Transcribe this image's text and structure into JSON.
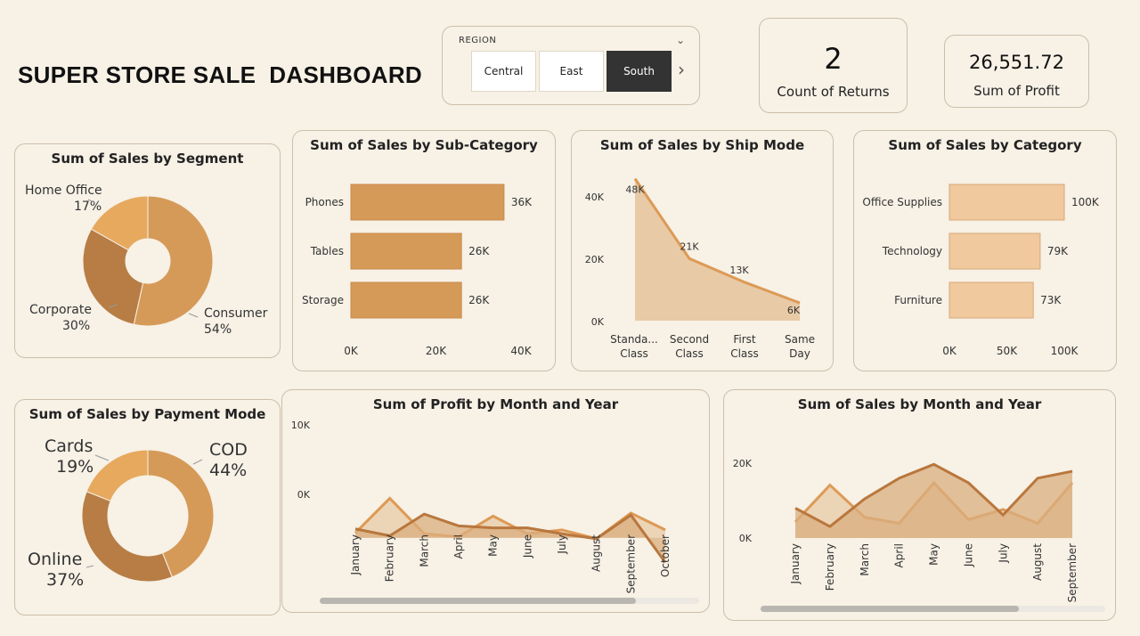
{
  "title": "SUPER STORE SALE  DASHBOARD",
  "slicer": {
    "label": "REGION",
    "options": [
      "Central",
      "East",
      "South"
    ],
    "selected": "South"
  },
  "kpis": {
    "returns": {
      "value": "2",
      "label": "Count of Returns"
    },
    "profit": {
      "value": "26,551.72",
      "label": "Sum of Profit"
    }
  },
  "colors": {
    "bg": "#f7f1e6",
    "seg_consumer": "#d69a58",
    "seg_corporate": "#b77d45",
    "seg_home": "#e7a95e",
    "bar": "#d69a58",
    "cat_bar": "#f0c99e",
    "area_fill": "#e8caa6",
    "line_dark": "#b9773d",
    "line_light": "#dd9a55"
  },
  "chart_data": [
    {
      "id": "segment",
      "type": "pie",
      "title": "Sum of Sales by Segment",
      "labels": [
        "Consumer",
        "Corporate",
        "Home Office"
      ],
      "values": [
        54,
        30,
        17
      ],
      "value_labels": [
        "54%",
        "30%",
        "17%"
      ]
    },
    {
      "id": "subcat",
      "type": "bar",
      "title": "Sum of Sales by Sub-Category",
      "categories": [
        "Phones",
        "Tables",
        "Storage"
      ],
      "values": [
        36,
        26,
        26
      ],
      "value_labels": [
        "36K",
        "26K",
        "26K"
      ],
      "ticks": [
        "0K",
        "20K",
        "40K"
      ],
      "xlim": [
        0,
        40
      ]
    },
    {
      "id": "shipmode",
      "type": "area",
      "title": "Sum of Sales by Ship Mode",
      "categories": [
        "Standa...\nClass",
        "Second\nClass",
        "First\nClass",
        "Same\nDay"
      ],
      "values": [
        48,
        21,
        13,
        6
      ],
      "value_labels": [
        "48K",
        "21K",
        "13K",
        "6K"
      ],
      "ticks": [
        "0K",
        "20K",
        "40K"
      ],
      "ylim": [
        0,
        50
      ]
    },
    {
      "id": "category",
      "type": "bar",
      "title": "Sum of Sales by Category",
      "categories": [
        "Office Supplies",
        "Technology",
        "Furniture"
      ],
      "values": [
        100,
        79,
        73
      ],
      "value_labels": [
        "100K",
        "79K",
        "73K"
      ],
      "ticks": [
        "0K",
        "50K",
        "100K"
      ],
      "xlim": [
        0,
        100
      ]
    },
    {
      "id": "payment",
      "type": "pie",
      "title": "Sum of Sales by Payment Mode",
      "labels": [
        "COD",
        "Online",
        "Cards"
      ],
      "values": [
        44,
        37,
        19
      ],
      "value_labels": [
        "44%",
        "37%",
        "19%"
      ]
    },
    {
      "id": "profit_month",
      "type": "area",
      "title": "Sum of Profit by Month and Year",
      "categories": [
        "January",
        "February",
        "March",
        "April",
        "May",
        "June",
        "July",
        "August",
        "September",
        "October"
      ],
      "series": [
        {
          "values": [
            0.5,
            4.0,
            0.4,
            0.1,
            2.2,
            0.4,
            0.8,
            -0.1,
            2.5,
            0.8
          ]
        },
        {
          "values": [
            0.9,
            0.2,
            2.4,
            1.2,
            1.0,
            1.0,
            0.4,
            -0.1,
            2.3,
            -2.5
          ]
        }
      ],
      "ticks": [
        "0K",
        "10K"
      ],
      "ylim": [
        -4,
        10
      ]
    },
    {
      "id": "sales_month",
      "type": "area",
      "title": "Sum of Sales by Month and Year",
      "categories": [
        "January",
        "February",
        "March",
        "April",
        "May",
        "June",
        "July",
        "August",
        "September"
      ],
      "series": [
        {
          "values": [
            3.5,
            11.5,
            4.5,
            3.2,
            12.0,
            4.0,
            6.2,
            3.2,
            12.0
          ]
        },
        {
          "values": [
            6.5,
            2.5,
            8.5,
            13.0,
            16.0,
            12.0,
            5.0,
            13.0,
            14.5
          ]
        }
      ],
      "ticks": [
        "0K",
        "20K"
      ],
      "ylim": [
        0,
        24
      ]
    }
  ]
}
